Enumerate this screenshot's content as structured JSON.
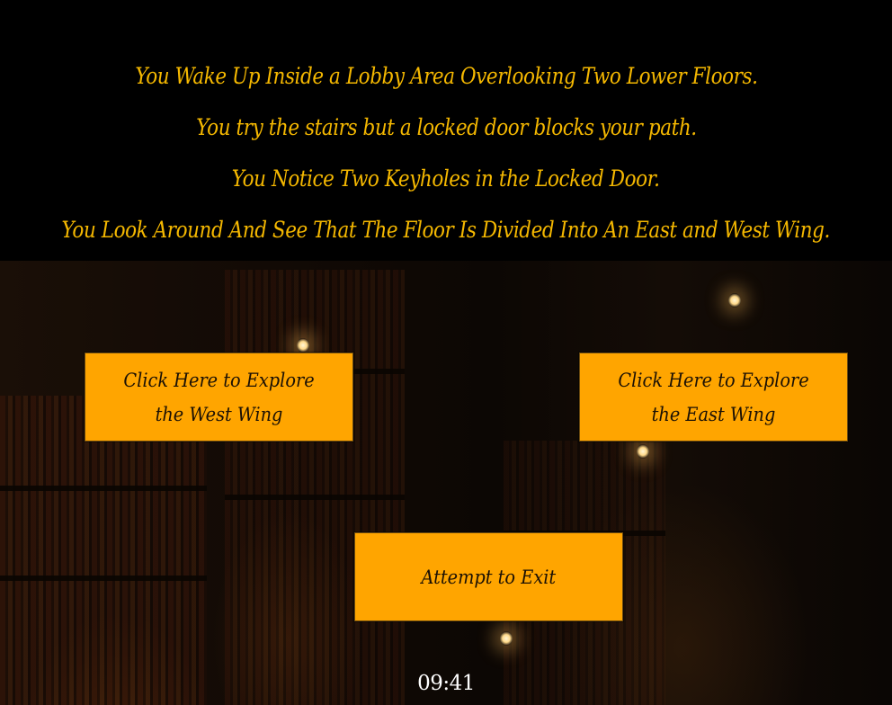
{
  "story": {
    "lines": [
      "You Wake Up Inside a Lobby Area Overlooking Two Lower Floors.",
      "You try the stairs but a locked door blocks your path.",
      "You Notice Two Keyholes in the Locked Door.",
      "You Look Around And See That The Floor Is Divided Into An East and West Wing."
    ]
  },
  "buttons": {
    "west_wing": "Click Here to Explore the West Wing",
    "east_wing": "Click Here to Explore the East Wing",
    "exit": "Attempt to Exit"
  },
  "timer": "09:41",
  "colors": {
    "story_text": "#f5b800",
    "button_bg": "#ffa500",
    "button_text": "#1a1005",
    "timer_text": "#ffffff",
    "header_bg": "#000000"
  }
}
